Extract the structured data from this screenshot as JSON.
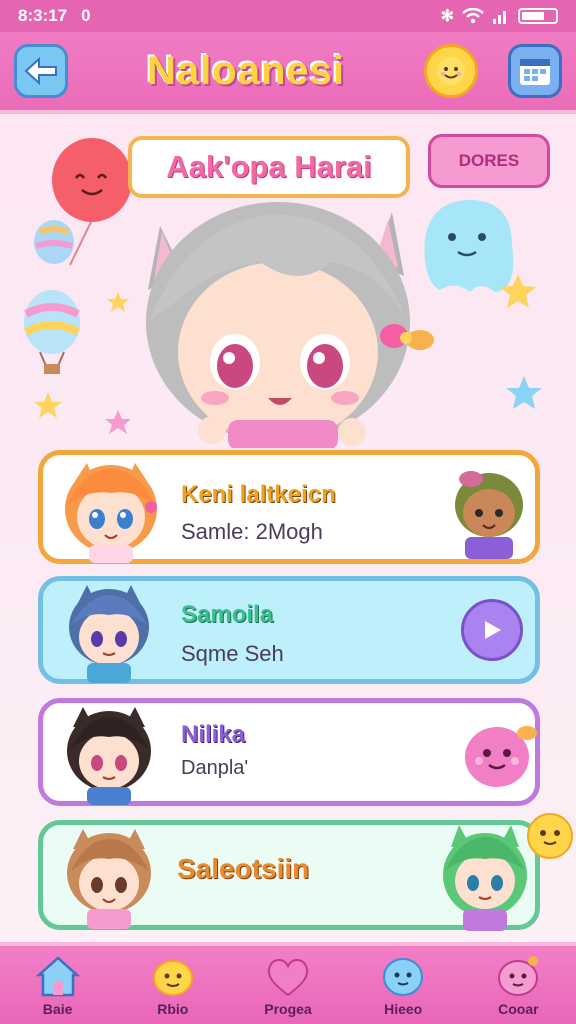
{
  "status": {
    "time": "8:3:17",
    "indicator": "0"
  },
  "app": {
    "title": "Naloanesi",
    "back_icon": "back-arrow-icon",
    "sun_icon": "smiling-sun-icon",
    "grid_icon": "calendar-grid-icon"
  },
  "hero": {
    "banner": "Aak'opa Harai",
    "action_button": "DORES"
  },
  "cards": [
    {
      "title": "Keni laltkeicn",
      "subtitle": "Samle: 2Mogh",
      "title_color": "#f0a11f"
    },
    {
      "title": "Samoila",
      "subtitle": "Sqme Seh",
      "title_color": "#3cbf8e",
      "action_icon": "play-button-icon"
    },
    {
      "title": "Nilika",
      "subtitle": "Danpla'",
      "title_color": "#8a5fd8"
    },
    {
      "title": "Saleotsiin",
      "subtitle": "",
      "title_color": "#e98a2b"
    }
  ],
  "nav": [
    {
      "label": "Baie",
      "icon": "house-icon"
    },
    {
      "label": "Rbio",
      "icon": "yellow-blob-icon"
    },
    {
      "label": "Progea",
      "icon": "heart-icon"
    },
    {
      "label": "Hieeo",
      "icon": "blue-blob-icon"
    },
    {
      "label": "Cooar",
      "icon": "pink-blob-icon"
    }
  ],
  "colors": {
    "accent": "#e565b2",
    "banner_text": "#f06aa8"
  }
}
